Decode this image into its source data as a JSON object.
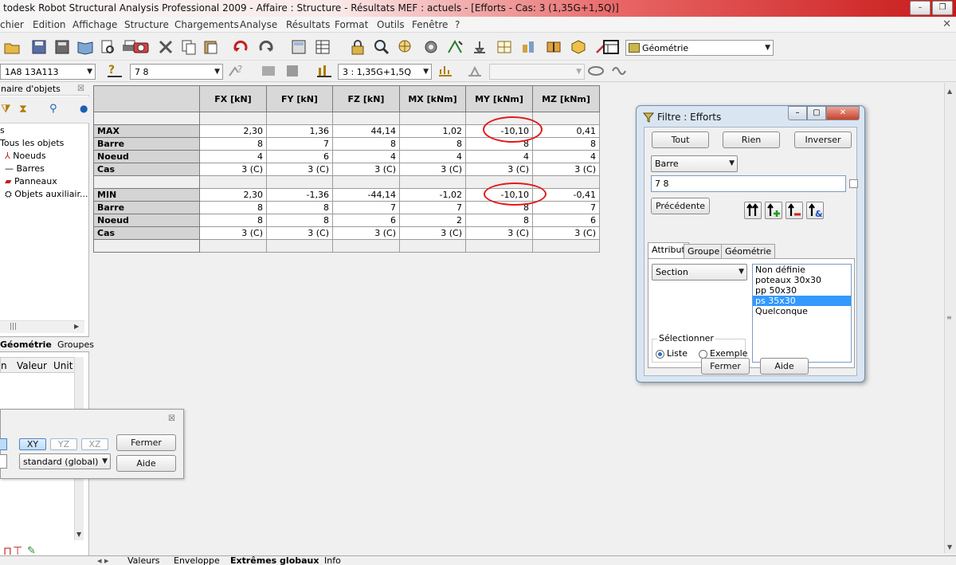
{
  "titlebar": {
    "title": "todesk Robot Structural Analysis Professional 2009 - Affaire : Structure - Résultats MEF : actuels - [Efforts - Cas: 3 (1,35G+1,5Q)]"
  },
  "menubar": {
    "items": [
      "chier",
      "Edition",
      "Affichage",
      "Structure",
      "Chargements",
      "Analyse",
      "Résultats",
      "Format",
      "Outils",
      "Fenêtre",
      "?"
    ]
  },
  "toolbar1": {
    "view_combo": "Géométrie"
  },
  "toolbar2": {
    "selection_combo": "1A8 13A113",
    "bar_input": "7 8",
    "case_combo": "3 : 1,35G+1,5Q"
  },
  "left_panel": {
    "header": "naire d'objets",
    "tree_root_label": "s",
    "tree": [
      "Tous les objets",
      "Noeuds",
      "Barres",
      "Panneaux",
      "Objets auxiliair..."
    ],
    "tabs": [
      "Géométrie",
      "Groupes"
    ],
    "props_columns": [
      "n",
      "Valeur",
      "Unit"
    ]
  },
  "view_dialog": {
    "plane_buttons": [
      "XY",
      "YZ",
      "XZ"
    ],
    "system_combo": "standard (global)",
    "close_label": "Fermer",
    "help_label": "Aide"
  },
  "results": {
    "columns": [
      "FX [kN]",
      "FY [kN]",
      "FZ [kN]",
      "MX [kNm]",
      "MY [kNm]",
      "MZ [kNm]"
    ],
    "rows": [
      {
        "label": "MAX",
        "values": [
          "2,30",
          "1,36",
          "44,14",
          "1,02",
          "-10,10",
          "0,41"
        ]
      },
      {
        "label": "Barre",
        "values": [
          "8",
          "7",
          "8",
          "8",
          "8",
          "8"
        ]
      },
      {
        "label": "Noeud",
        "values": [
          "4",
          "6",
          "4",
          "4",
          "4",
          "4"
        ]
      },
      {
        "label": "Cas",
        "values": [
          "3 (C)",
          "3 (C)",
          "3 (C)",
          "3 (C)",
          "3 (C)",
          "3 (C)"
        ]
      },
      {
        "label": "MIN",
        "values": [
          "2,30",
          "-1,36",
          "-44,14",
          "-1,02",
          "-10,10",
          "-0,41"
        ]
      },
      {
        "label": "Barre",
        "values": [
          "8",
          "8",
          "7",
          "7",
          "8",
          "7"
        ]
      },
      {
        "label": "Noeud",
        "values": [
          "8",
          "8",
          "6",
          "2",
          "8",
          "6"
        ]
      },
      {
        "label": "Cas",
        "values": [
          "3 (C)",
          "3 (C)",
          "3 (C)",
          "3 (C)",
          "3 (C)",
          "3 (C)"
        ]
      }
    ]
  },
  "filter_dialog": {
    "title": "Filtre : Efforts",
    "all_label": "Tout",
    "none_label": "Rien",
    "invert_label": "Inverser",
    "type_combo": "Barre",
    "selection_value": "7 8",
    "previous_label": "Précédente",
    "tabs": [
      "Attribut",
      "Groupe",
      "Géométrie"
    ],
    "attribute_combo": "Section",
    "sections": [
      "Non définie",
      "poteaux 30x30",
      "pp 50x30",
      "ps 35x30",
      "Quelconque"
    ],
    "selected_section": "ps 35x30",
    "select_group_label": "Sélectionner",
    "radio_list": "Liste",
    "radio_example": "Exemple",
    "close_label": "Fermer",
    "help_label": "Aide"
  },
  "bottom_tabs": [
    "Valeurs",
    "Enveloppe",
    "Extrêmes globaux",
    "Info"
  ]
}
